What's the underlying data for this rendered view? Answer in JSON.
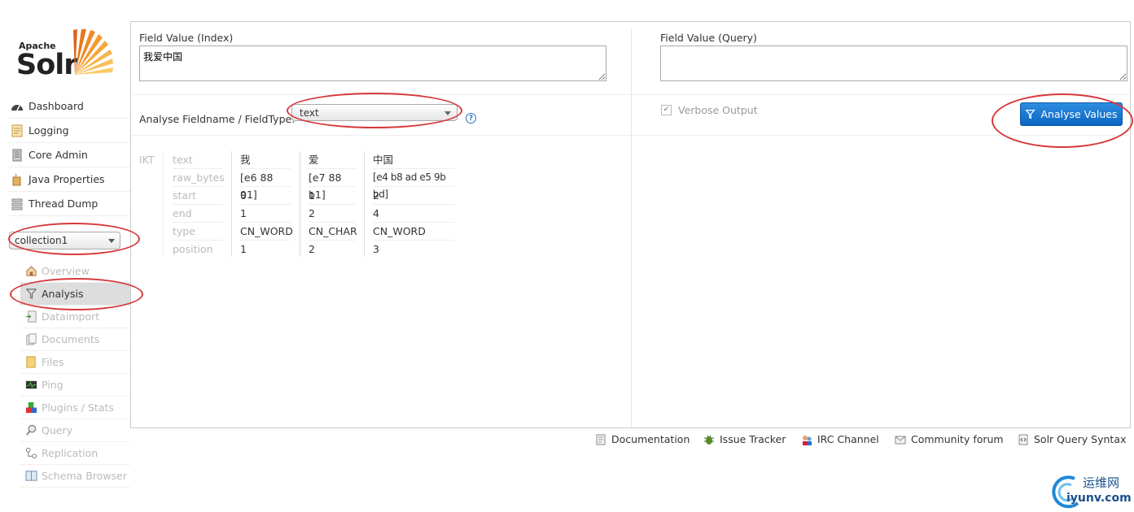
{
  "logo": {
    "apache": "Apache",
    "solr": "Solr"
  },
  "nav": [
    {
      "label": "Dashboard",
      "icon": "dashboard-icon"
    },
    {
      "label": "Logging",
      "icon": "logging-icon"
    },
    {
      "label": "Core Admin",
      "icon": "core-admin-icon"
    },
    {
      "label": "Java Properties",
      "icon": "java-icon"
    },
    {
      "label": "Thread Dump",
      "icon": "thread-dump-icon"
    }
  ],
  "core_selector": {
    "value": "collection1"
  },
  "core_menu": [
    {
      "label": "Overview",
      "icon": "home-icon"
    },
    {
      "label": "Analysis",
      "icon": "filter-icon"
    },
    {
      "label": "Dataimport",
      "icon": "dataimport-icon"
    },
    {
      "label": "Documents",
      "icon": "documents-icon"
    },
    {
      "label": "Files",
      "icon": "files-icon"
    },
    {
      "label": "Ping",
      "icon": "ping-icon"
    },
    {
      "label": "Plugins / Stats",
      "icon": "plugins-icon"
    },
    {
      "label": "Query",
      "icon": "query-icon"
    },
    {
      "label": "Replication",
      "icon": "replication-icon"
    },
    {
      "label": "Schema Browser",
      "icon": "schema-icon"
    }
  ],
  "analysis": {
    "index_label": "Field Value (Index)",
    "index_value": "我爱中国",
    "query_label": "Field Value (Query)",
    "query_value": "",
    "fieldname_label": "Analyse Fieldname / FieldType:",
    "fieldtype_value": "text",
    "help": "?",
    "verbose_label": "Verbose Output",
    "verbose_checked": true,
    "button_label": "Analyse Values"
  },
  "result": {
    "analyzer": "IKT",
    "row_labels": [
      "text",
      "raw_bytes",
      "start",
      "end",
      "type",
      "position"
    ],
    "tokens": [
      [
        "我",
        "[e6 88 91]",
        "0",
        "1",
        "CN_WORD",
        "1"
      ],
      [
        "爱",
        "[e7 88 b1]",
        "1",
        "2",
        "CN_CHAR",
        "2"
      ],
      [
        "中国",
        "[e4 b8 ad e5 9b bd]",
        "2",
        "4",
        "CN_WORD",
        "3"
      ]
    ]
  },
  "footer": [
    {
      "label": "Documentation",
      "icon": "documentation-icon"
    },
    {
      "label": "Issue Tracker",
      "icon": "bug-icon"
    },
    {
      "label": "IRC Channel",
      "icon": "irc-icon"
    },
    {
      "label": "Community forum",
      "icon": "mail-icon"
    },
    {
      "label": "Solr Query Syntax",
      "icon": "syntax-icon"
    }
  ],
  "watermark": {
    "cn": "运维网",
    "url": "iyunv.com"
  },
  "colors": {
    "annotation": "#d6393b",
    "button": "#1a73cf"
  }
}
